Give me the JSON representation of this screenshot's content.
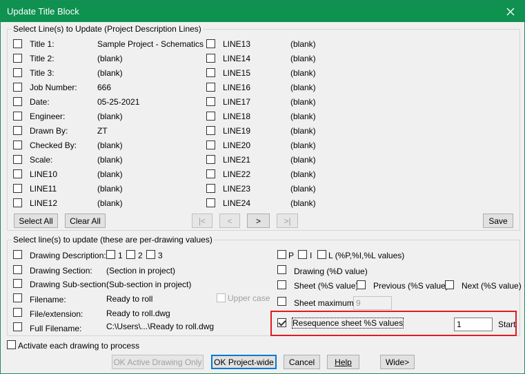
{
  "window": {
    "title": "Update Title Block"
  },
  "group1": {
    "title": "Select Line(s) to Update (Project Description Lines)",
    "left": [
      {
        "label": "Title 1:",
        "value": "Sample Project - Schematics"
      },
      {
        "label": "Title 2:",
        "value": "(blank)"
      },
      {
        "label": "Title 3:",
        "value": "(blank)"
      },
      {
        "label": "Job Number:",
        "value": "666"
      },
      {
        "label": "Date:",
        "value": "05-25-2021"
      },
      {
        "label": "Engineer:",
        "value": "(blank)"
      },
      {
        "label": "Drawn By:",
        "value": "ZT"
      },
      {
        "label": "Checked By:",
        "value": "(blank)"
      },
      {
        "label": "Scale:",
        "value": "(blank)"
      },
      {
        "label": "LINE10",
        "value": "(blank)"
      },
      {
        "label": "LINE11",
        "value": "(blank)"
      },
      {
        "label": "LINE12",
        "value": "(blank)"
      }
    ],
    "right": [
      {
        "label": "LINE13",
        "value": "(blank)"
      },
      {
        "label": "LINE14",
        "value": "(blank)"
      },
      {
        "label": "LINE15",
        "value": "(blank)"
      },
      {
        "label": "LINE16",
        "value": "(blank)"
      },
      {
        "label": "LINE17",
        "value": "(blank)"
      },
      {
        "label": "LINE18",
        "value": "(blank)"
      },
      {
        "label": "LINE19",
        "value": "(blank)"
      },
      {
        "label": "LINE20",
        "value": "(blank)"
      },
      {
        "label": "LINE21",
        "value": "(blank)"
      },
      {
        "label": "LINE22",
        "value": "(blank)"
      },
      {
        "label": "LINE23",
        "value": "(blank)"
      },
      {
        "label": "LINE24",
        "value": "(blank)"
      }
    ],
    "select_all": "Select All",
    "clear_all": "Clear All",
    "nav_first": "|<",
    "nav_prev": "<",
    "nav_next": ">",
    "nav_last": ">|",
    "save": "Save"
  },
  "group2": {
    "title": "Select line(s) to update (these are per-drawing values)",
    "drawing_description": "Drawing Description:",
    "opt_1": "1",
    "opt_2": "2",
    "opt_3": "3",
    "drawing_section": "Drawing Section:",
    "drawing_section_value": "(Section in project)",
    "drawing_subsection": "Drawing Sub-section:",
    "drawing_subsection_value": "(Sub-section in project)",
    "filename": "Filename:",
    "filename_value": "Ready to roll",
    "upper_case": "Upper case",
    "file_extension": "File/extension:",
    "file_extension_value": "Ready to roll.dwg",
    "full_filename": "Full Filename:",
    "full_filename_value": "C:\\Users\\...\\Ready to roll.dwg",
    "p": "P",
    "i": "I",
    "l_values": "L (%P,%I,%L values)",
    "drawing_d": "Drawing (%D value)",
    "sheet_s": "Sheet (%S value)",
    "previous_s": "Previous (%S value)",
    "next_s": "Next (%S value)",
    "sheet_maximum": "Sheet maximum:",
    "sheet_maximum_value": "9",
    "resequence": "Resequence sheet %S values",
    "start_value": "1",
    "start_label": "Start"
  },
  "footer": {
    "activate_each": "Activate each drawing to process",
    "ok_active": "OK Active Drawing Only",
    "ok_project": "OK Project-wide",
    "cancel": "Cancel",
    "help": "Help",
    "wide": "Wide>"
  }
}
